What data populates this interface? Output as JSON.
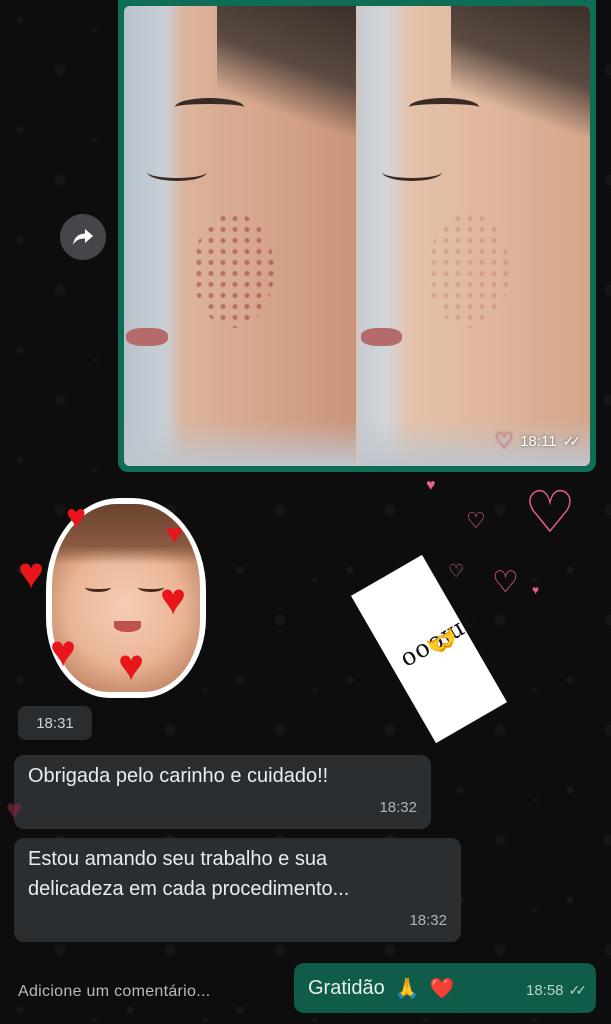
{
  "image_message": {
    "time": "18:11",
    "status": "read-double-check"
  },
  "sticker": {
    "time": "18:31"
  },
  "annotation": {
    "text": "Amooo",
    "emoji": "🫶"
  },
  "messages": [
    {
      "text": "Obrigada pelo carinho e cuidado!!",
      "time": "18:32"
    },
    {
      "line1": "Estou amando seu trabalho e sua",
      "line2": "delicadeza em cada procedimento...",
      "time": "18:32"
    }
  ],
  "outgoing": {
    "text": "Gratidão",
    "emoji_pray": "🙏",
    "emoji_heart": "❤️",
    "time": "18:58"
  },
  "composer": {
    "placeholder": "Adicione um comentário..."
  },
  "colors": {
    "incoming_bubble": "#2b2e31",
    "outgoing_bubble": "#0f5c4b",
    "image_border": "#0f6d55",
    "heart_red": "#e8161b",
    "heart_pink": "#e8608a"
  }
}
